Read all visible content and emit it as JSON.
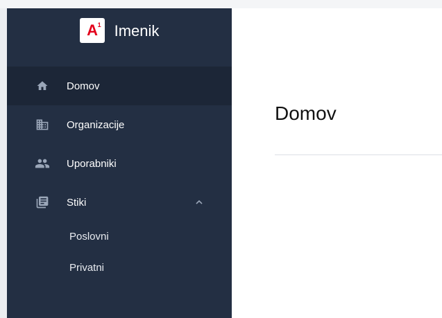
{
  "app": {
    "logo_text": "A1",
    "title": "Imenik"
  },
  "sidebar": {
    "items": [
      {
        "label": "Domov",
        "icon": "home-icon",
        "active": true
      },
      {
        "label": "Organizacije",
        "icon": "building-icon",
        "active": false
      },
      {
        "label": "Uporabniki",
        "icon": "people-icon",
        "active": false
      },
      {
        "label": "Stiki",
        "icon": "contacts-book-icon",
        "active": false,
        "expanded": true
      }
    ],
    "sub_items": [
      {
        "label": "Poslovni"
      },
      {
        "label": "Privatni"
      }
    ]
  },
  "main": {
    "page_title": "Domov"
  },
  "colors": {
    "sidebar_bg": "#232f43",
    "active_item_bg": "#1c2637",
    "icon_color": "#9aa6b8",
    "brand_red": "#e3001b"
  }
}
